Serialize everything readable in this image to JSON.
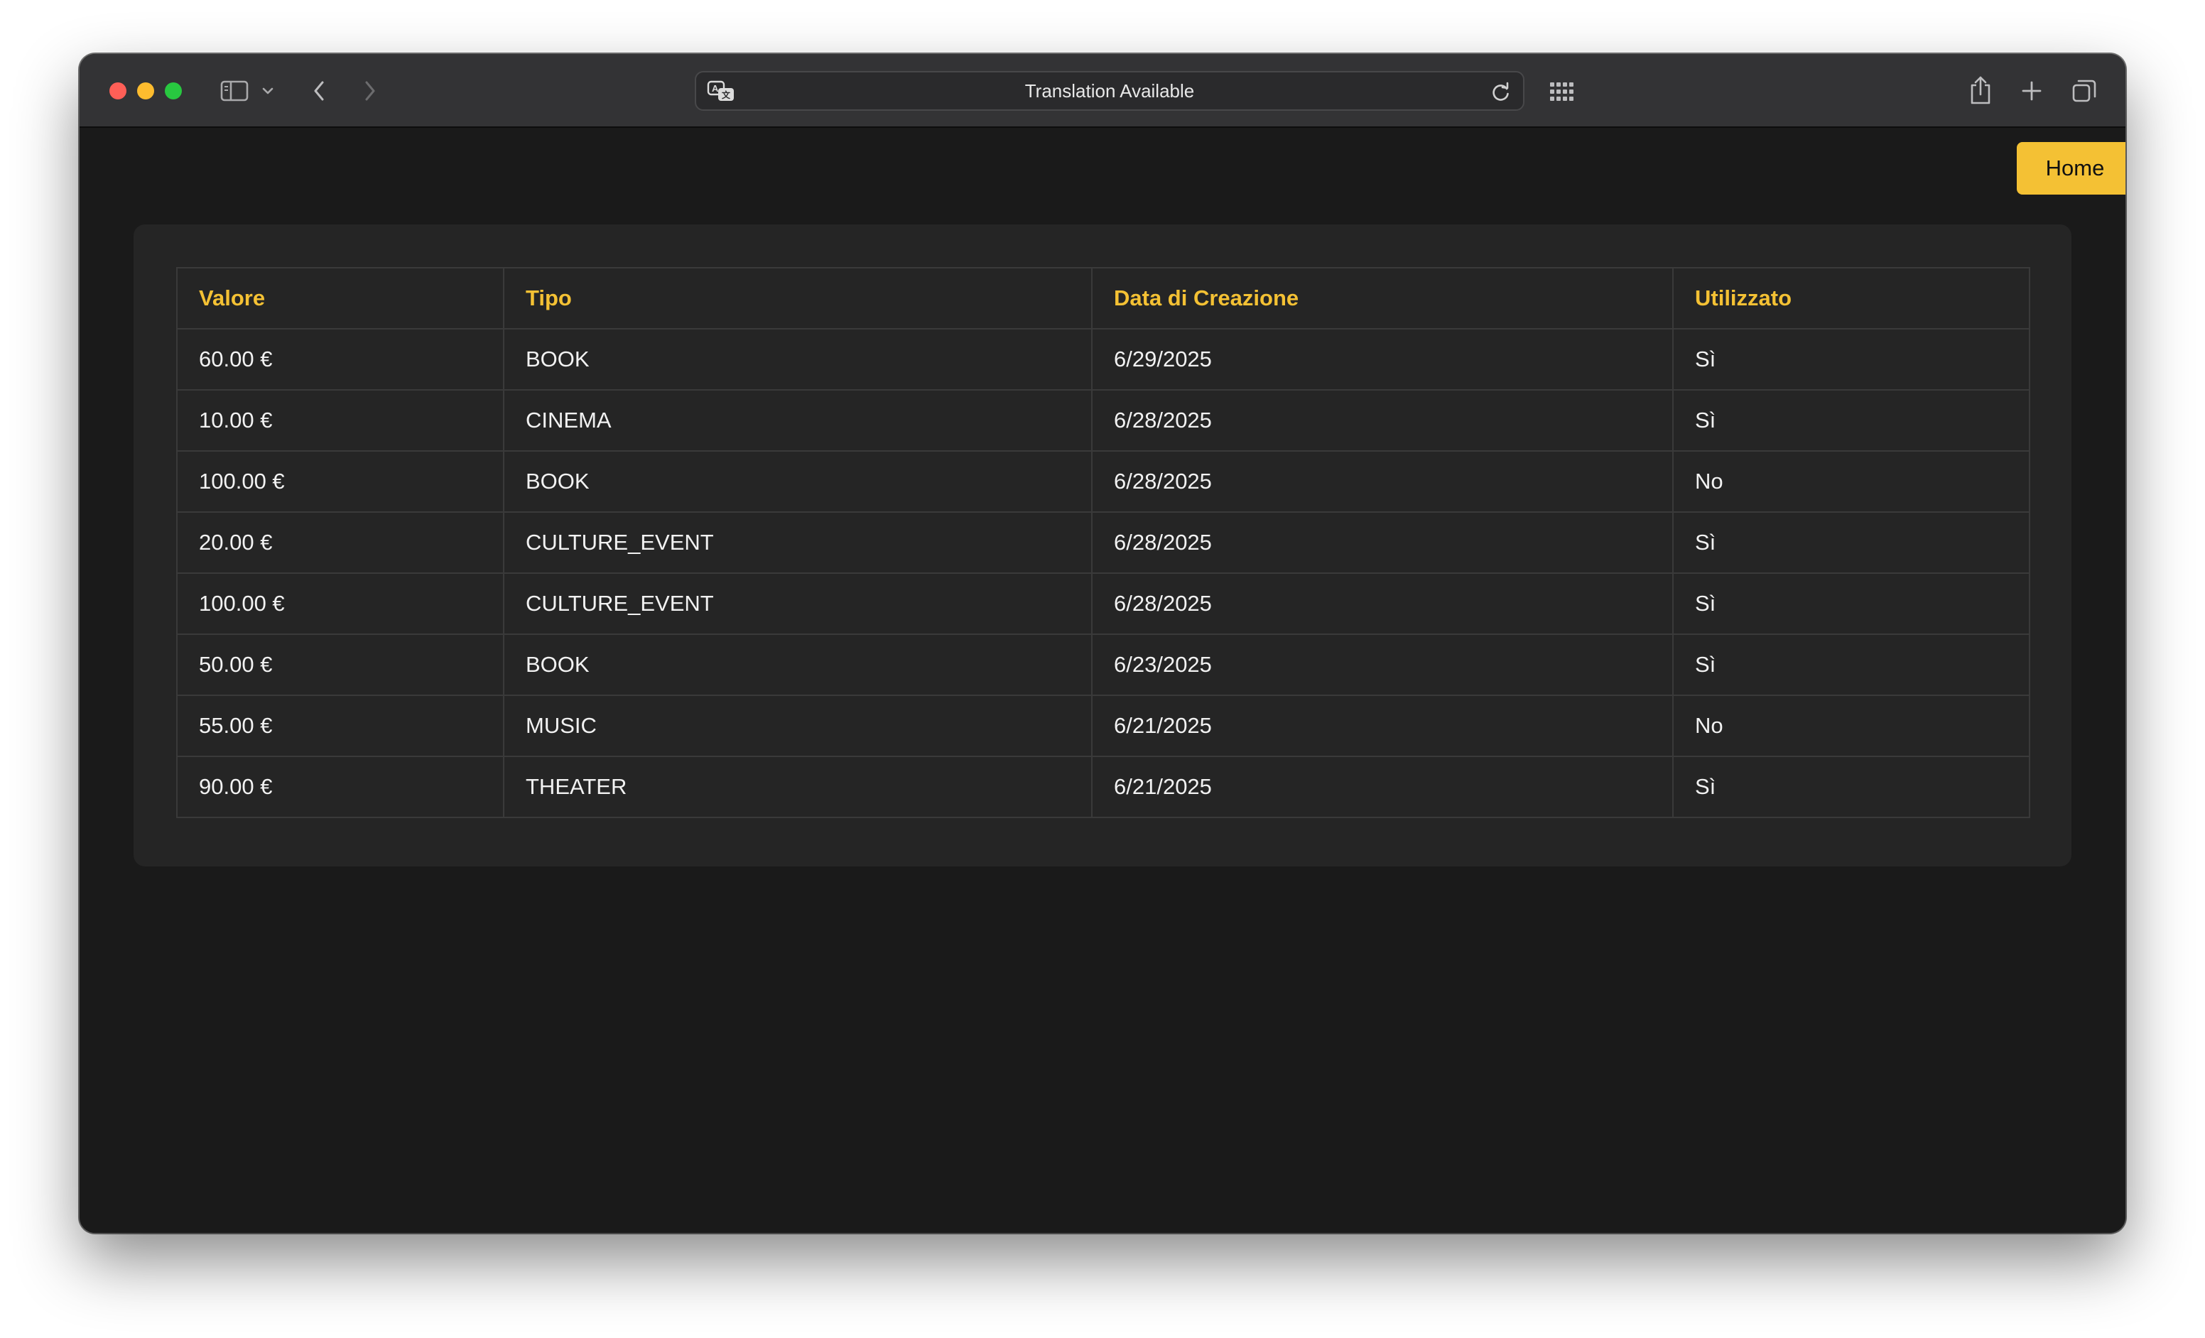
{
  "browser": {
    "address_text": "Translation Available",
    "icons": {
      "sidebar": "sidebar-icon",
      "chevron_down": "chevron-down-icon",
      "back": "back-arrow-icon",
      "forward": "forward-arrow-icon",
      "translate": "translate-icon",
      "reload": "reload-icon",
      "grid": "grid-icon",
      "share": "share-icon",
      "new_tab": "plus-icon",
      "tabs_overview": "tabs-overview-icon"
    }
  },
  "page": {
    "home_label": "Home",
    "accent_color": "#f4c134",
    "table": {
      "headers": [
        "Valore",
        "Tipo",
        "Data di Creazione",
        "Utilizzato"
      ],
      "rows": [
        [
          "60.00 €",
          "BOOK",
          "6/29/2025",
          "Sì"
        ],
        [
          "10.00 €",
          "CINEMA",
          "6/28/2025",
          "Sì"
        ],
        [
          "100.00 €",
          "BOOK",
          "6/28/2025",
          "No"
        ],
        [
          "20.00 €",
          "CULTURE_EVENT",
          "6/28/2025",
          "Sì"
        ],
        [
          "100.00 €",
          "CULTURE_EVENT",
          "6/28/2025",
          "Sì"
        ],
        [
          "50.00 €",
          "BOOK",
          "6/23/2025",
          "Sì"
        ],
        [
          "55.00 €",
          "MUSIC",
          "6/21/2025",
          "No"
        ],
        [
          "90.00 €",
          "THEATER",
          "6/21/2025",
          "Sì"
        ]
      ]
    }
  }
}
